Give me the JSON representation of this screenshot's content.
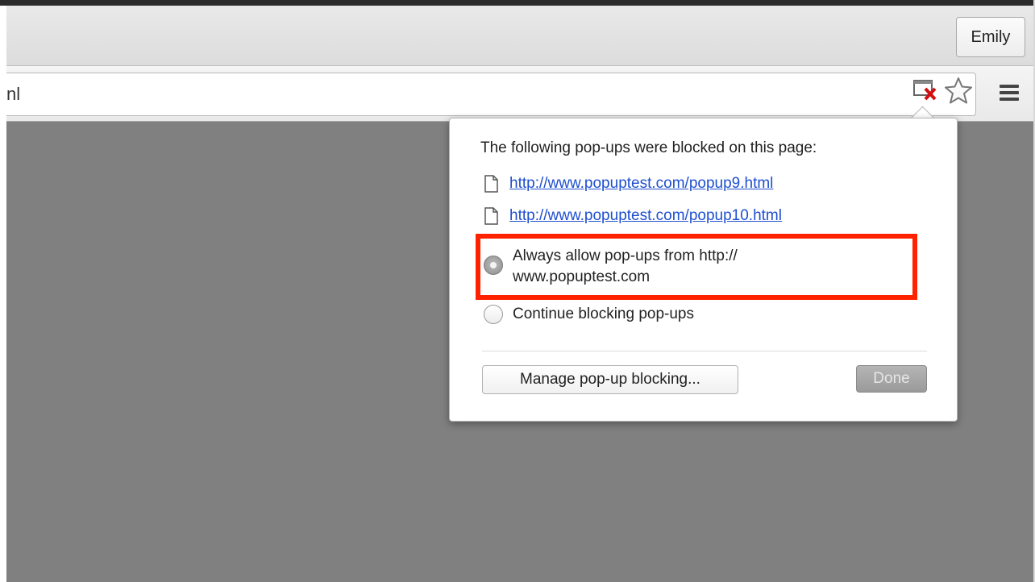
{
  "profile": {
    "name": "Emily"
  },
  "omnibox": {
    "url_fragment": "nl"
  },
  "icons": {
    "popup_blocked": "popup-blocked-icon",
    "star": "star-icon",
    "menu": "hamburger-menu-icon",
    "document": "document-icon"
  },
  "colors": {
    "link": "#1f4fd0",
    "highlight": "#ff2200",
    "content_background": "#808080"
  },
  "bubble": {
    "title": "The following pop-ups were blocked on this page:",
    "blocked_popups": [
      "http://www.popuptest.com/popup9.html",
      "http://www.popuptest.com/popup10.html"
    ],
    "options": [
      {
        "label_line1": "Always allow pop-ups from http://",
        "label_line2": "www.popuptest.com",
        "selected": true
      },
      {
        "label_line1": "Continue blocking pop-ups",
        "selected": false
      }
    ],
    "manage_label": "Manage pop-up blocking...",
    "done_label": "Done"
  }
}
